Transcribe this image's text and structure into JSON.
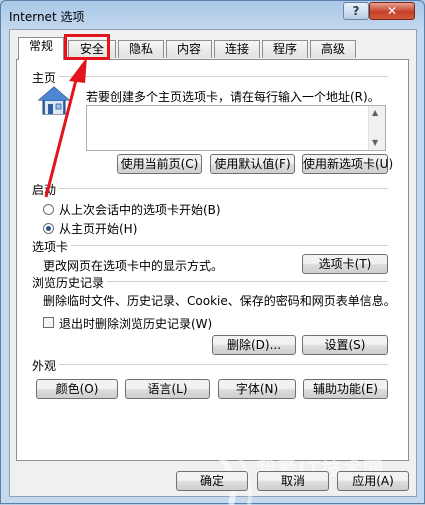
{
  "window": {
    "title": "Internet 选项",
    "help": "?",
    "close": "✕"
  },
  "tabs": [
    "常规",
    "安全",
    "隐私",
    "内容",
    "连接",
    "程序",
    "高级"
  ],
  "home": {
    "heading": "主页",
    "instruction": "若要创建多个主页选项卡，请在每行输入一个地址(R)。",
    "buttons": [
      "使用当前页(C)",
      "使用默认值(F)",
      "使用新选项卡(U)"
    ]
  },
  "startup": {
    "heading": "启动",
    "options": [
      "从上次会话中的选项卡开始(B)",
      "从主页开始(H)"
    ],
    "selected": 1
  },
  "tabs_section": {
    "heading": "选项卡",
    "desc": "更改网页在选项卡中的显示方式。",
    "button": "选项卡(T)"
  },
  "history": {
    "heading": "浏览历史记录",
    "desc": "删除临时文件、历史记录、Cookie、保存的密码和网页表单信息。",
    "checkbox": "退出时删除浏览历史记录(W)",
    "delete_btn": "删除(D)...",
    "settings_btn": "设置(S)"
  },
  "appearance": {
    "heading": "外观",
    "buttons": [
      "颜色(O)",
      "语言(L)",
      "字体(N)",
      "辅助功能(E)"
    ]
  },
  "footer": {
    "ok": "确定",
    "cancel": "取消",
    "apply": "应用(A)"
  },
  "watermark": "我爱IT技术网",
  "colors": {
    "highlight": "#e3141b",
    "arrow": "#e3141b"
  }
}
